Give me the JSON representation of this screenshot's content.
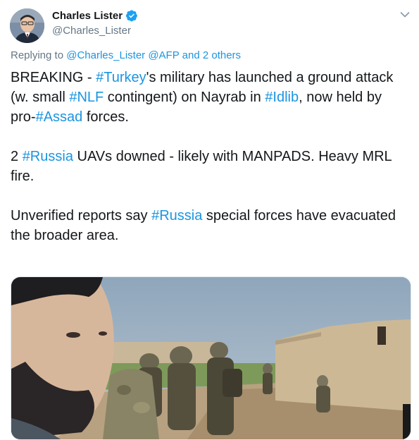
{
  "author": {
    "display_name": "Charles Lister",
    "handle": "@Charles_Lister"
  },
  "reply": {
    "prefix": "Replying to",
    "users": [
      "@Charles_Lister",
      "@AFP"
    ],
    "and": "and",
    "others": "2 others"
  },
  "body": {
    "p1": [
      {
        "t": "BREAKING - ",
        "h": false
      },
      {
        "t": "#Turkey",
        "h": true
      },
      {
        "t": "'s military has launched a ground attack (w. small ",
        "h": false
      },
      {
        "t": "#NLF",
        "h": true
      },
      {
        "t": " contingent) on Nayrab in ",
        "h": false
      },
      {
        "t": "#Idlib",
        "h": true
      },
      {
        "t": ",",
        "h": false
      },
      {
        "t": " now held by pro-",
        "h": false
      },
      {
        "t": "#Assad",
        "h": true
      },
      {
        "t": " forces.",
        "h": false
      }
    ],
    "p2": [
      {
        "t": "2 ",
        "h": false
      },
      {
        "t": "#Russia",
        "h": true
      },
      {
        "t": " UAVs downed - likely with MANPADS. Heavy MRL fire.",
        "h": false
      }
    ],
    "p3": [
      {
        "t": "Unverified reports say ",
        "h": false
      },
      {
        "t": "#Russia",
        "h": true
      },
      {
        "t": " special forces have evacuated the broader area.",
        "h": false
      }
    ]
  },
  "media": {
    "type": "video-thumbnail"
  },
  "icons": {
    "verified": "verified-badge-icon",
    "menu": "chevron-down-icon"
  },
  "colors": {
    "link": "#1b95e0",
    "text": "#14171a",
    "secondary": "#657786"
  }
}
